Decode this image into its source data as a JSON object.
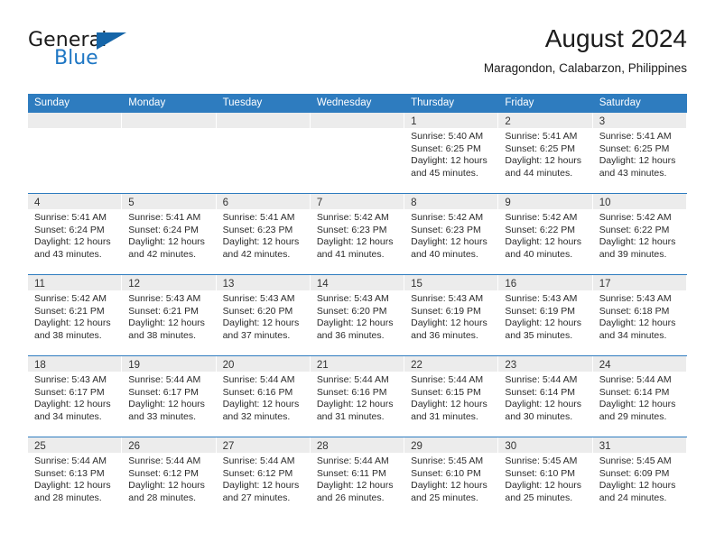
{
  "brand": {
    "name_top": "General",
    "name_bottom": "Blue",
    "triangle_color": "#1565a8",
    "blue_color": "#1f77c4"
  },
  "header": {
    "title": "August 2024",
    "subtitle": "Maragondon, Calabarzon, Philippines"
  },
  "colors": {
    "header_blue": "#2e7cbf",
    "day_band_gray": "#ececec",
    "text": "#2b2b2b"
  },
  "weekdays": [
    "Sunday",
    "Monday",
    "Tuesday",
    "Wednesday",
    "Thursday",
    "Friday",
    "Saturday"
  ],
  "labels": {
    "sunrise": "Sunrise:",
    "sunset": "Sunset:",
    "daylight": "Daylight:"
  },
  "weeks": [
    [
      {
        "day": "",
        "empty": true
      },
      {
        "day": "",
        "empty": true
      },
      {
        "day": "",
        "empty": true
      },
      {
        "day": "",
        "empty": true
      },
      {
        "day": "1",
        "sunrise": "Sunrise: 5:40 AM",
        "sunset": "Sunset: 6:25 PM",
        "daylight": "Daylight: 12 hours and 45 minutes."
      },
      {
        "day": "2",
        "sunrise": "Sunrise: 5:41 AM",
        "sunset": "Sunset: 6:25 PM",
        "daylight": "Daylight: 12 hours and 44 minutes."
      },
      {
        "day": "3",
        "sunrise": "Sunrise: 5:41 AM",
        "sunset": "Sunset: 6:25 PM",
        "daylight": "Daylight: 12 hours and 43 minutes."
      }
    ],
    [
      {
        "day": "4",
        "sunrise": "Sunrise: 5:41 AM",
        "sunset": "Sunset: 6:24 PM",
        "daylight": "Daylight: 12 hours and 43 minutes."
      },
      {
        "day": "5",
        "sunrise": "Sunrise: 5:41 AM",
        "sunset": "Sunset: 6:24 PM",
        "daylight": "Daylight: 12 hours and 42 minutes."
      },
      {
        "day": "6",
        "sunrise": "Sunrise: 5:41 AM",
        "sunset": "Sunset: 6:23 PM",
        "daylight": "Daylight: 12 hours and 42 minutes."
      },
      {
        "day": "7",
        "sunrise": "Sunrise: 5:42 AM",
        "sunset": "Sunset: 6:23 PM",
        "daylight": "Daylight: 12 hours and 41 minutes."
      },
      {
        "day": "8",
        "sunrise": "Sunrise: 5:42 AM",
        "sunset": "Sunset: 6:23 PM",
        "daylight": "Daylight: 12 hours and 40 minutes."
      },
      {
        "day": "9",
        "sunrise": "Sunrise: 5:42 AM",
        "sunset": "Sunset: 6:22 PM",
        "daylight": "Daylight: 12 hours and 40 minutes."
      },
      {
        "day": "10",
        "sunrise": "Sunrise: 5:42 AM",
        "sunset": "Sunset: 6:22 PM",
        "daylight": "Daylight: 12 hours and 39 minutes."
      }
    ],
    [
      {
        "day": "11",
        "sunrise": "Sunrise: 5:42 AM",
        "sunset": "Sunset: 6:21 PM",
        "daylight": "Daylight: 12 hours and 38 minutes."
      },
      {
        "day": "12",
        "sunrise": "Sunrise: 5:43 AM",
        "sunset": "Sunset: 6:21 PM",
        "daylight": "Daylight: 12 hours and 38 minutes."
      },
      {
        "day": "13",
        "sunrise": "Sunrise: 5:43 AM",
        "sunset": "Sunset: 6:20 PM",
        "daylight": "Daylight: 12 hours and 37 minutes."
      },
      {
        "day": "14",
        "sunrise": "Sunrise: 5:43 AM",
        "sunset": "Sunset: 6:20 PM",
        "daylight": "Daylight: 12 hours and 36 minutes."
      },
      {
        "day": "15",
        "sunrise": "Sunrise: 5:43 AM",
        "sunset": "Sunset: 6:19 PM",
        "daylight": "Daylight: 12 hours and 36 minutes."
      },
      {
        "day": "16",
        "sunrise": "Sunrise: 5:43 AM",
        "sunset": "Sunset: 6:19 PM",
        "daylight": "Daylight: 12 hours and 35 minutes."
      },
      {
        "day": "17",
        "sunrise": "Sunrise: 5:43 AM",
        "sunset": "Sunset: 6:18 PM",
        "daylight": "Daylight: 12 hours and 34 minutes."
      }
    ],
    [
      {
        "day": "18",
        "sunrise": "Sunrise: 5:43 AM",
        "sunset": "Sunset: 6:17 PM",
        "daylight": "Daylight: 12 hours and 34 minutes."
      },
      {
        "day": "19",
        "sunrise": "Sunrise: 5:44 AM",
        "sunset": "Sunset: 6:17 PM",
        "daylight": "Daylight: 12 hours and 33 minutes."
      },
      {
        "day": "20",
        "sunrise": "Sunrise: 5:44 AM",
        "sunset": "Sunset: 6:16 PM",
        "daylight": "Daylight: 12 hours and 32 minutes."
      },
      {
        "day": "21",
        "sunrise": "Sunrise: 5:44 AM",
        "sunset": "Sunset: 6:16 PM",
        "daylight": "Daylight: 12 hours and 31 minutes."
      },
      {
        "day": "22",
        "sunrise": "Sunrise: 5:44 AM",
        "sunset": "Sunset: 6:15 PM",
        "daylight": "Daylight: 12 hours and 31 minutes."
      },
      {
        "day": "23",
        "sunrise": "Sunrise: 5:44 AM",
        "sunset": "Sunset: 6:14 PM",
        "daylight": "Daylight: 12 hours and 30 minutes."
      },
      {
        "day": "24",
        "sunrise": "Sunrise: 5:44 AM",
        "sunset": "Sunset: 6:14 PM",
        "daylight": "Daylight: 12 hours and 29 minutes."
      }
    ],
    [
      {
        "day": "25",
        "sunrise": "Sunrise: 5:44 AM",
        "sunset": "Sunset: 6:13 PM",
        "daylight": "Daylight: 12 hours and 28 minutes."
      },
      {
        "day": "26",
        "sunrise": "Sunrise: 5:44 AM",
        "sunset": "Sunset: 6:12 PM",
        "daylight": "Daylight: 12 hours and 28 minutes."
      },
      {
        "day": "27",
        "sunrise": "Sunrise: 5:44 AM",
        "sunset": "Sunset: 6:12 PM",
        "daylight": "Daylight: 12 hours and 27 minutes."
      },
      {
        "day": "28",
        "sunrise": "Sunrise: 5:44 AM",
        "sunset": "Sunset: 6:11 PM",
        "daylight": "Daylight: 12 hours and 26 minutes."
      },
      {
        "day": "29",
        "sunrise": "Sunrise: 5:45 AM",
        "sunset": "Sunset: 6:10 PM",
        "daylight": "Daylight: 12 hours and 25 minutes."
      },
      {
        "day": "30",
        "sunrise": "Sunrise: 5:45 AM",
        "sunset": "Sunset: 6:10 PM",
        "daylight": "Daylight: 12 hours and 25 minutes."
      },
      {
        "day": "31",
        "sunrise": "Sunrise: 5:45 AM",
        "sunset": "Sunset: 6:09 PM",
        "daylight": "Daylight: 12 hours and 24 minutes."
      }
    ]
  ]
}
